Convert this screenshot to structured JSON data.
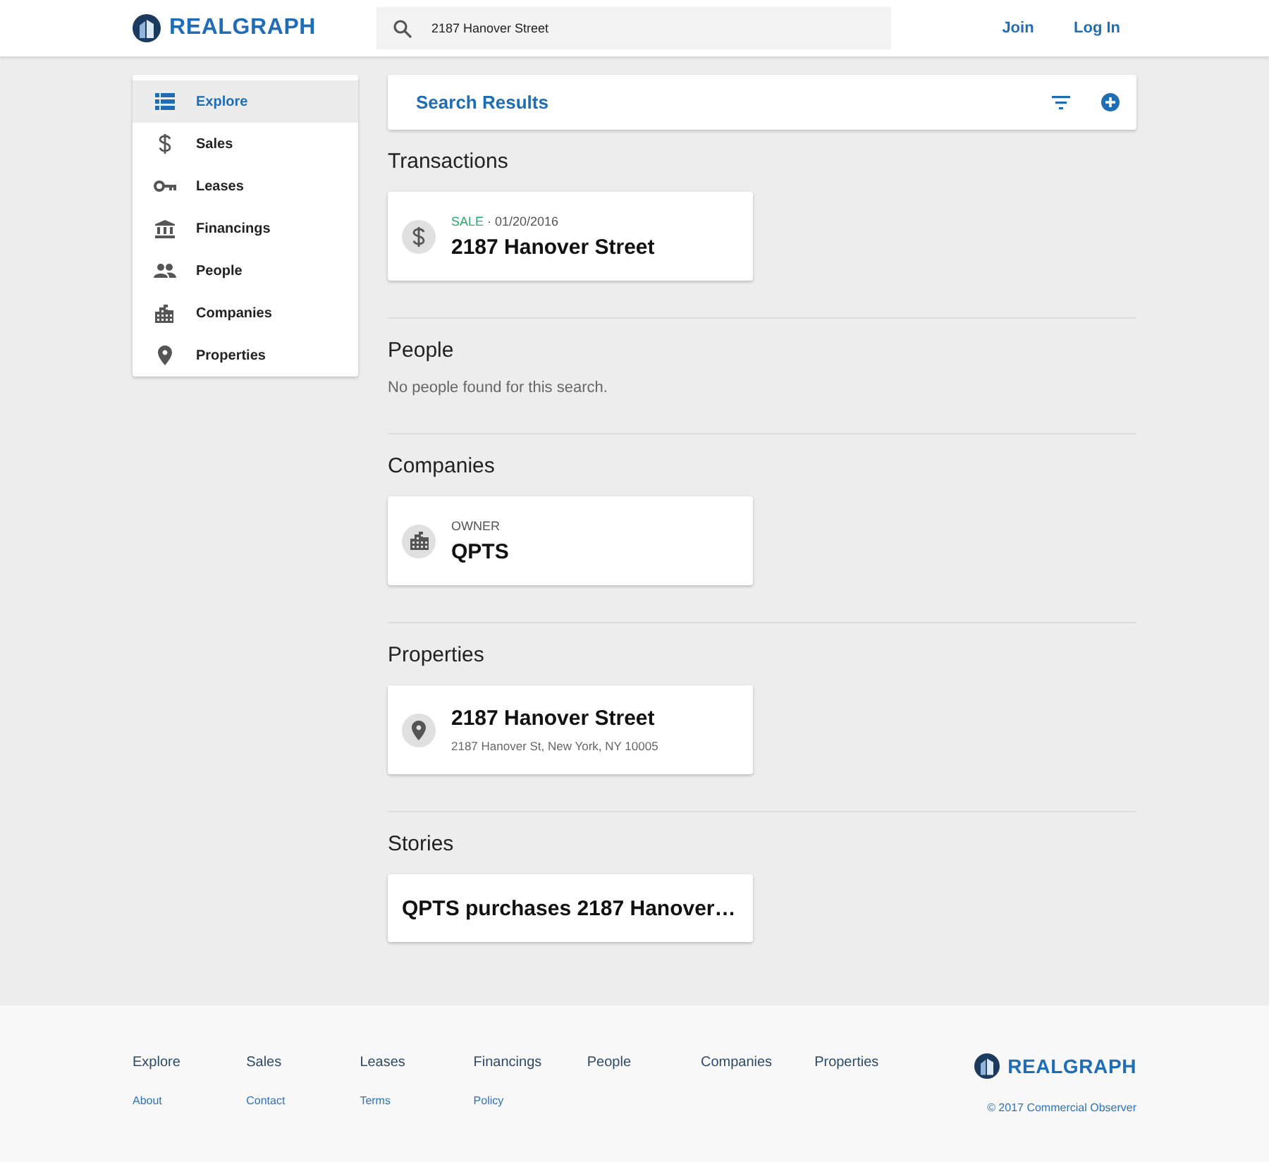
{
  "header": {
    "brand": "REALGRAPH",
    "search": {
      "value": "2187 Hanover Street"
    },
    "links": [
      "Join",
      "Log In"
    ]
  },
  "sidebar": {
    "items": [
      {
        "label": "Explore",
        "selected": true
      },
      {
        "label": "Sales",
        "selected": false
      },
      {
        "label": "Leases",
        "selected": false
      },
      {
        "label": "Financings",
        "selected": false
      },
      {
        "label": "People",
        "selected": false
      },
      {
        "label": "Companies",
        "selected": false
      },
      {
        "label": "Properties",
        "selected": false
      }
    ]
  },
  "results": {
    "title": "Search Results"
  },
  "sections": [
    {
      "heading": "Transactions",
      "cards": [
        {
          "kind": "transaction",
          "tag": "SALE",
          "date": "· 01/20/2016",
          "title": "2187 Hanover Street"
        }
      ]
    },
    {
      "heading": "People",
      "empty_text": "No people found for this search."
    },
    {
      "heading": "Companies",
      "cards": [
        {
          "kind": "company",
          "label": "OWNER",
          "title": "QPTS"
        }
      ]
    },
    {
      "heading": "Properties",
      "cards": [
        {
          "kind": "property",
          "title": "2187 Hanover Street",
          "address": "2187 Hanover St, New York, NY 10005"
        }
      ]
    },
    {
      "heading": "Stories",
      "cards": [
        {
          "kind": "story",
          "title": "QPTS purchases 2187 Hanover…"
        }
      ]
    }
  ],
  "footer": {
    "nav": [
      "Explore",
      "Sales",
      "Leases",
      "Financings",
      "People",
      "Companies",
      "Properties"
    ],
    "links": [
      "About",
      "Contact",
      "Terms",
      "Policy"
    ],
    "brand": "REALGRAPH",
    "copyright": "© 2017 Commercial Observer"
  }
}
